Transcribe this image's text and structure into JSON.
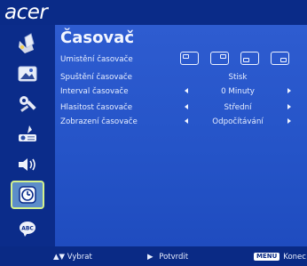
{
  "header": {
    "logo": "acer"
  },
  "page": {
    "title": "Časovač"
  },
  "settings": {
    "position": {
      "label": "Umistění časovače",
      "options": [
        "top-left",
        "top-right",
        "bottom-left",
        "bottom-right"
      ]
    },
    "start": {
      "label": "Spuštění časovače",
      "value": "Stisk"
    },
    "interval": {
      "label": "Interval časovače",
      "value": "0  Minuty"
    },
    "volume": {
      "label": "Hlasitost časovače",
      "value": "Střední"
    },
    "display": {
      "label": "Zobrazení časovače",
      "value": "Odpočítávání"
    }
  },
  "sidebar": {
    "items": [
      {
        "name": "color-settings",
        "icon": "palette-icon"
      },
      {
        "name": "image-settings",
        "icon": "picture-icon"
      },
      {
        "name": "management",
        "icon": "gear-wrench-icon"
      },
      {
        "name": "projector-settings",
        "icon": "projector-icon"
      },
      {
        "name": "audio",
        "icon": "speaker-icon"
      },
      {
        "name": "timer",
        "icon": "clock-icon"
      },
      {
        "name": "language",
        "icon": "abc-icon"
      }
    ],
    "active_index": 5
  },
  "footer": {
    "select_label": "Vybrat",
    "confirm_label": "Potvrdit",
    "menu_key": "MENU",
    "exit_label": "Konec"
  }
}
